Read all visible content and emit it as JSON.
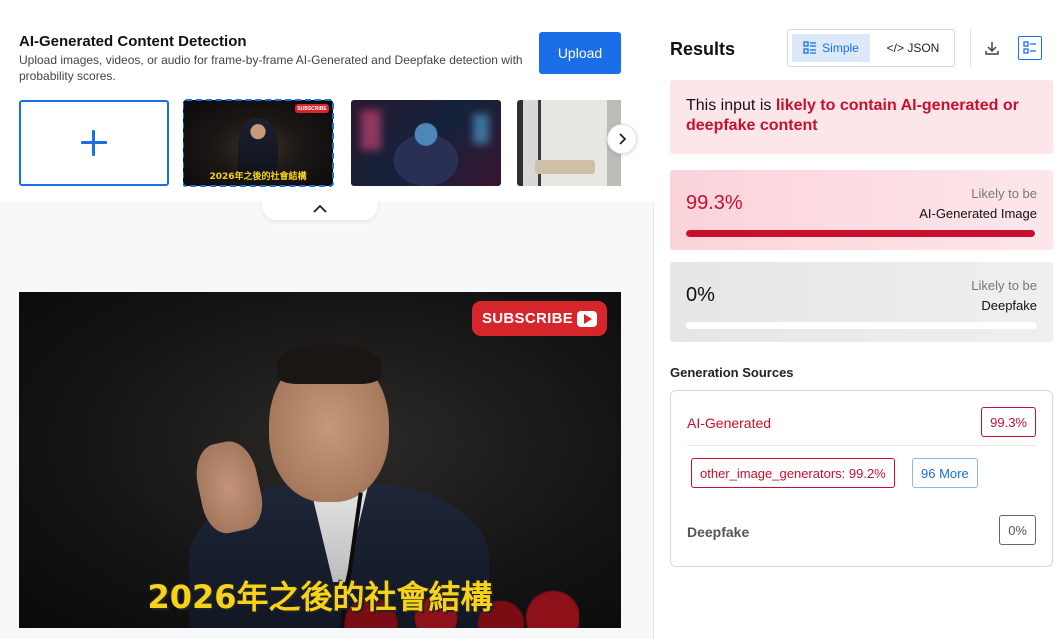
{
  "header": {
    "title": "AI-Generated Content Detection",
    "subtitle": "Upload images, videos, or audio for frame-by-frame AI-Generated and Deepfake detection with probability scores.",
    "upload_label": "Upload"
  },
  "thumbnails": {
    "add_icon": "plus-icon",
    "items": [
      {
        "name": "speaker-video",
        "badge": "SUBSCRIBE",
        "caption": "2026年之後的社會結構",
        "selected": true
      },
      {
        "name": "cyberpunk-portrait",
        "selected": false
      },
      {
        "name": "living-room",
        "selected": false
      }
    ],
    "next_icon": "chevron-right-icon",
    "collapse_icon": "chevron-up-icon"
  },
  "preview": {
    "badge": "SUBSCRIBE",
    "caption": "2026年之後的社會結構"
  },
  "results": {
    "title": "Results",
    "view_toggle": {
      "simple": "Simple",
      "json": "</> JSON",
      "selected": "simple"
    },
    "verdict": {
      "prefix": "This input is ",
      "highlight": "likely to contain AI-generated or deepfake content"
    },
    "scores": [
      {
        "key": "ai",
        "value": "99.3%",
        "likely": "Likely to be",
        "label": "AI-Generated Image",
        "fraction": 0.993
      },
      {
        "key": "deepfake",
        "value": "0%",
        "likely": "Likely to be",
        "label": "Deepfake",
        "fraction": 0.0
      }
    ],
    "generation_sources": {
      "title": "Generation Sources",
      "ai_label": "AI-Generated",
      "ai_value": "99.3%",
      "model_chip": "other_image_generators: 99.2%",
      "more_chip": "96 More",
      "deepfake_label": "Deepfake",
      "deepfake_value": "0%"
    }
  },
  "colors": {
    "accent": "#1a6fe8",
    "alert": "#c8102e",
    "verdict_bg": "#fde6ea"
  }
}
